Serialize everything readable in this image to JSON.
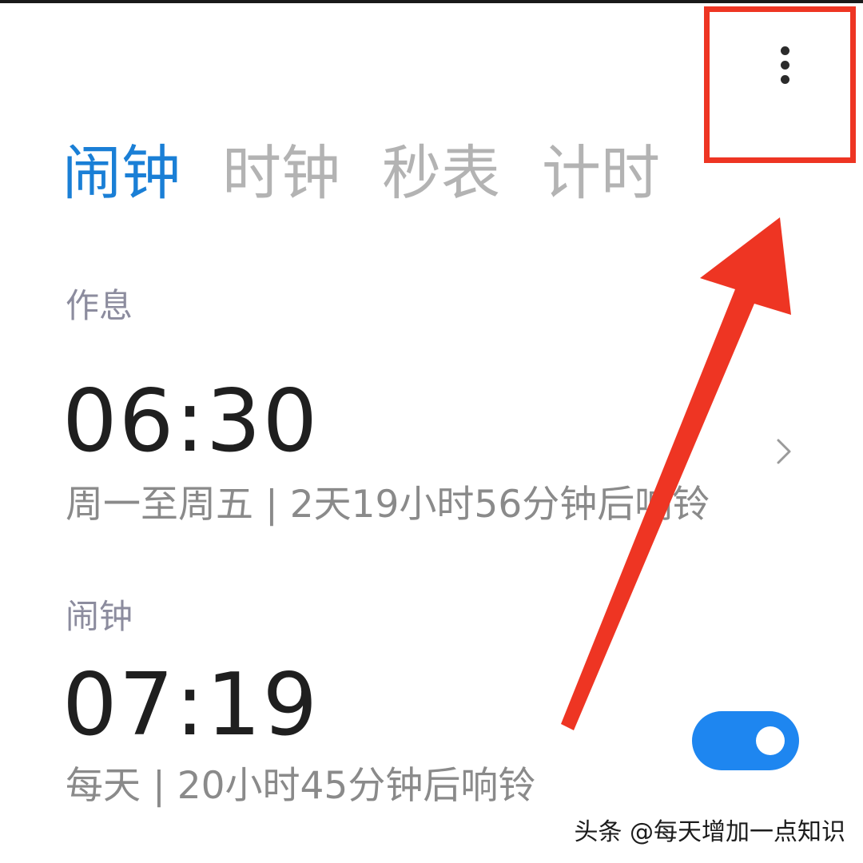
{
  "tabs": [
    {
      "label": "闹钟",
      "active": true
    },
    {
      "label": "时钟",
      "active": false
    },
    {
      "label": "秒表",
      "active": false
    },
    {
      "label": "计时",
      "active": false
    }
  ],
  "sections": {
    "schedule_label": "作息",
    "alarm_label": "闹钟"
  },
  "alarms": [
    {
      "time": "06:30",
      "description": "周一至周五 | 2天19小时56分钟后响铃",
      "control": "chevron-right-icon"
    },
    {
      "time": "07:19",
      "description": "每天 | 20小时45分钟后响铃",
      "control": "toggle",
      "enabled": true
    }
  ],
  "menu": {
    "icon": "more-vertical-icon"
  },
  "annotation": {
    "color": "#ee3523"
  },
  "colors": {
    "accent": "#1a7fd6",
    "toggle_on": "#1e86f0",
    "tab_inactive": "#b3b3b3"
  },
  "watermark": "头条 @每天增加一点知识"
}
